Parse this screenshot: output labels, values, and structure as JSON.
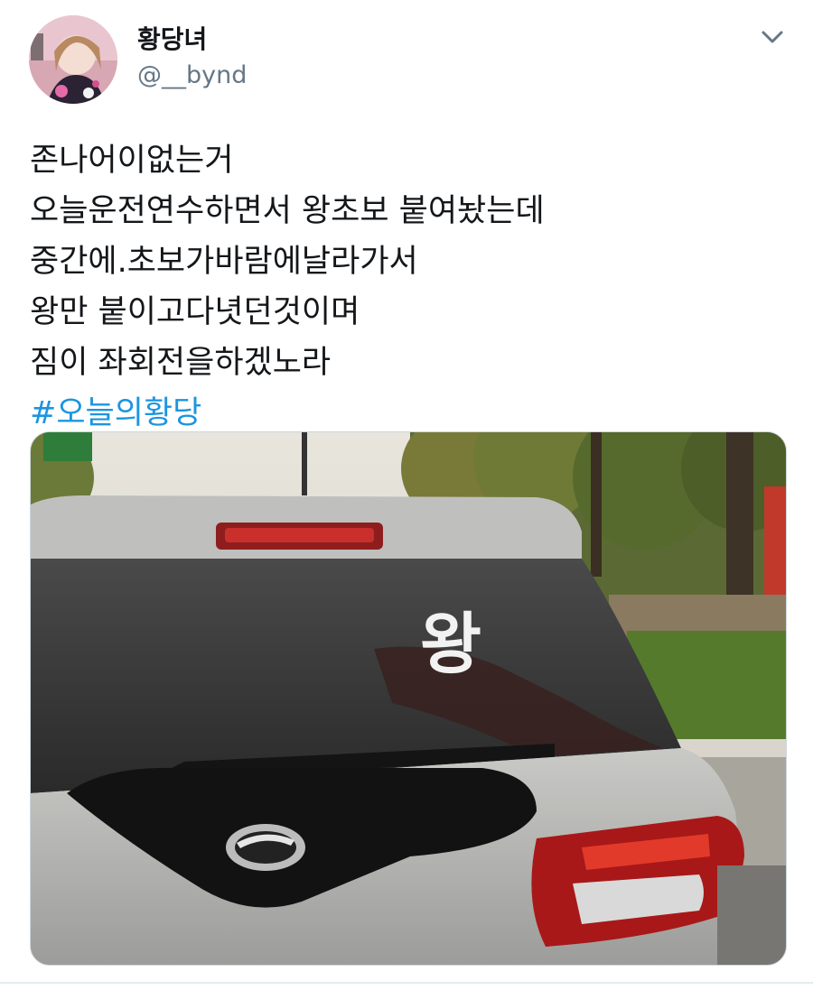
{
  "author": {
    "display_name": "황당녀",
    "handle": "@__bynd"
  },
  "tweet": {
    "lines": [
      "존나어이없는거",
      "오늘운전연수하면서 왕초보 붙여놨는데",
      "중간에.초보가바람에날라가서",
      "왕만 붙이고다녓던것이며",
      "짐이 좌회전을하겠노라"
    ],
    "hashtag": "#오늘의황당"
  },
  "media": {
    "sticker_text": "왕"
  },
  "icons": {
    "menu": "chevron-down-icon"
  },
  "colors": {
    "hashtag": "#1b95e0",
    "handle": "#657786",
    "text": "#14171a"
  }
}
